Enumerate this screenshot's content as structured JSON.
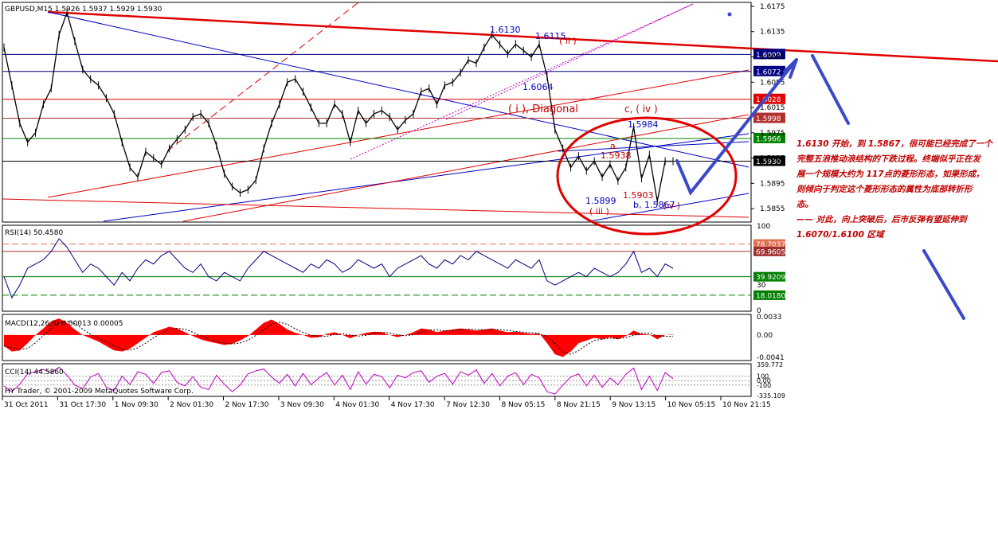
{
  "window": {
    "symbol_line": "GBPUSD,M15 1.5926 1.5937 1.5929 1.5930",
    "copyright": "HY Trader, © 2001-2009 MetaQuotes Software Corp."
  },
  "colors": {
    "price": "#000000",
    "trend_red": "#e00000",
    "trend_blue": "#0000c0",
    "hline_blue": "#000080",
    "hline_red": "#e00000",
    "hline_green": "#008000",
    "rsi": "#000080",
    "macd": "#ff0000",
    "cci": "#c000c0",
    "annotation_blue": "#3b49c8",
    "note_red": "#c00000"
  },
  "annotations": {
    "labels": [
      {
        "text": "1.6130",
        "color": "#0000c0"
      },
      {
        "text": "1.6115",
        "color": "#0000c0"
      },
      {
        "text": "( ii )",
        "color": "#c00000"
      },
      {
        "text": "1.6064",
        "color": "#0000c0"
      },
      {
        "text": "( i ), Diagonal",
        "color": "#c00000"
      },
      {
        "text": "c, ( iv )",
        "color": "#c00000"
      },
      {
        "text": "1.5984",
        "color": "#0000c0"
      },
      {
        "text": "a",
        "color": "#c00000"
      },
      {
        "text": "1.5938",
        "color": "#c00000"
      },
      {
        "text": "1.5899",
        "color": "#0000c0"
      },
      {
        "text": "( iii )",
        "color": "#c00000"
      },
      {
        "text": "1.5903",
        "color": "#c00000"
      },
      {
        "text": "b, 1.5867",
        "color": "#0000c0"
      },
      {
        "text": "( v )",
        "color": "#c00000"
      }
    ],
    "note_lines": [
      "1.6130 开始，到 1.5867，很可能已经完成了一个",
      "完整五浪推动浪结构的下跌过程。终端似乎正在发",
      "展一个规模大约为 117点的菱形形态，如果形成，",
      "则倾向于判定这个菱形形态的属性为底部转折形",
      "态。",
      "—— 对此，向上突破后，后市反弹有望延伸到",
      "1.6070/1.6100 区域"
    ]
  },
  "chart_data": [
    {
      "type": "line",
      "panel": "price",
      "title": "GBPUSD,M15 1.5926 1.5937 1.5929 1.5930",
      "ylim": [
        1.5835,
        1.618
      ],
      "y_ticks": [
        "1.6175",
        "1.6135",
        "1.6095",
        "1.6055",
        "1.6015",
        "1.5975",
        "1.5935",
        "1.5895",
        "1.5855"
      ],
      "x_ticks": [
        "31 Oct 2011",
        "31 Oct 17:30",
        "1 Nov 09:30",
        "2 Nov 01:30",
        "2 Nov 17:30",
        "3 Nov 09:30",
        "4 Nov 01:30",
        "4 Nov 17:30",
        "7 Nov 12:30",
        "8 Nov 05:15",
        "8 Nov 21:15",
        "9 Nov 13:15",
        "10 Nov 05:15",
        "10 Nov 21:15"
      ],
      "x": [
        0,
        1,
        2,
        3,
        4,
        5,
        6,
        7,
        8,
        9,
        10,
        11,
        12,
        13,
        14,
        15,
        16,
        17,
        18,
        19,
        20,
        21,
        22,
        23,
        24,
        25,
        26,
        27,
        28,
        29,
        30,
        31,
        32,
        33,
        34,
        35,
        36,
        37,
        38,
        39,
        40,
        41,
        42,
        43,
        44,
        45,
        46,
        47,
        48,
        49,
        50,
        51,
        52,
        53,
        54,
        55,
        56,
        57,
        58,
        59,
        60,
        61,
        62,
        63,
        64,
        65,
        66,
        67,
        68,
        69,
        70,
        71,
        72,
        73,
        74,
        75,
        76,
        77,
        78,
        79,
        80,
        81,
        82,
        83,
        84,
        85
      ],
      "series": [
        {
          "name": "",
          "values": [
            1.611,
            1.605,
            1.599,
            1.596,
            1.5975,
            1.602,
            1.6045,
            1.613,
            1.6165,
            1.612,
            1.6075,
            1.606,
            1.605,
            1.603,
            1.6005,
            1.596,
            1.592,
            1.5905,
            1.5945,
            1.5935,
            1.5925,
            1.595,
            1.5965,
            1.598,
            1.6,
            1.6005,
            1.599,
            1.5955,
            1.591,
            1.589,
            1.588,
            1.5885,
            1.59,
            1.595,
            1.599,
            1.602,
            1.6055,
            1.606,
            1.604,
            1.6015,
            1.599,
            1.599,
            1.602,
            1.6005,
            1.596,
            1.601,
            1.599,
            1.6005,
            1.601,
            1.6,
            1.598,
            1.5995,
            1.6005,
            1.604,
            1.6045,
            1.602,
            1.605,
            1.6055,
            1.607,
            1.609,
            1.6085,
            1.611,
            1.613,
            1.6115,
            1.61,
            1.6115,
            1.6105,
            1.6095,
            1.6115,
            1.6064,
            1.598,
            1.595,
            1.592,
            1.5938,
            1.5915,
            1.593,
            1.5905,
            1.5925,
            1.5899,
            1.592,
            1.5984,
            1.5903,
            1.594,
            1.5867,
            1.593,
            1.593
          ]
        }
      ],
      "horizontal_lines": [
        {
          "value": 1.6099,
          "label": "1.6099",
          "color": "#000080"
        },
        {
          "value": 1.6072,
          "label": "1.6072",
          "color": "#000080"
        },
        {
          "value": 1.6028,
          "label": "1.6028",
          "color": "#e00000"
        },
        {
          "value": 1.5998,
          "label": "1.5998",
          "color": "#b03030"
        },
        {
          "value": 1.5966,
          "label": "1.5966",
          "color": "#008000"
        },
        {
          "value": 1.593,
          "label": "1.5930",
          "color": "#000000"
        }
      ],
      "grid": false
    },
    {
      "type": "line",
      "panel": "rsi",
      "title": "RSI(14) 50.4580",
      "ylim": [
        0,
        100
      ],
      "y_ticks": [
        "100",
        "30",
        "0"
      ],
      "levels": [
        {
          "value": 78.7037,
          "label": "78.7037",
          "color": "#e07050"
        },
        {
          "value": 69.9605,
          "label": "69.9605",
          "color": "#a03030"
        },
        {
          "value": 39.9209,
          "label": "39.9209",
          "color": "#008000"
        },
        {
          "value": 18.018,
          "label": "18.0180",
          "color": "#008000"
        }
      ],
      "x": [
        0,
        1,
        2,
        3,
        4,
        5,
        6,
        7,
        8,
        9,
        10,
        11,
        12,
        13,
        14,
        15,
        16,
        17,
        18,
        19,
        20,
        21,
        22,
        23,
        24,
        25,
        26,
        27,
        28,
        29,
        30,
        31,
        32,
        33,
        34,
        35,
        36,
        37,
        38,
        39,
        40,
        41,
        42,
        43,
        44,
        45,
        46,
        47,
        48,
        49,
        50,
        51,
        52,
        53,
        54,
        55,
        56,
        57,
        58,
        59,
        60,
        61,
        62,
        63,
        64,
        65,
        66,
        67,
        68,
        69,
        70,
        71,
        72,
        73,
        74,
        75,
        76,
        77,
        78,
        79,
        80,
        81,
        82,
        83,
        84,
        85
      ],
      "series": [
        {
          "name": "",
          "values": [
            40,
            15,
            30,
            50,
            55,
            60,
            70,
            85,
            75,
            60,
            45,
            55,
            50,
            40,
            30,
            45,
            35,
            50,
            60,
            55,
            65,
            70,
            60,
            50,
            45,
            55,
            40,
            35,
            45,
            40,
            35,
            50,
            60,
            70,
            65,
            60,
            55,
            50,
            45,
            55,
            50,
            60,
            55,
            45,
            50,
            60,
            55,
            50,
            55,
            40,
            50,
            55,
            60,
            65,
            55,
            50,
            60,
            55,
            65,
            60,
            70,
            65,
            60,
            55,
            50,
            60,
            55,
            50,
            60,
            35,
            30,
            35,
            40,
            45,
            40,
            50,
            45,
            40,
            45,
            55,
            70,
            45,
            50,
            40,
            55,
            50
          ]
        }
      ]
    },
    {
      "type": "area",
      "panel": "macd",
      "title": "MACD(12,26,9) 0.00013 0.00005",
      "ylim": [
        -0.0045,
        0.0036
      ],
      "y_ticks": [
        "0.0033",
        "0.00",
        "-0.0041"
      ],
      "x": [
        0,
        1,
        2,
        3,
        4,
        5,
        6,
        7,
        8,
        9,
        10,
        11,
        12,
        13,
        14,
        15,
        16,
        17,
        18,
        19,
        20,
        21,
        22,
        23,
        24,
        25,
        26,
        27,
        28,
        29,
        30,
        31,
        32,
        33,
        34,
        35,
        36,
        37,
        38,
        39,
        40,
        41,
        42,
        43,
        44,
        45,
        46,
        47,
        48,
        49,
        50,
        51,
        52,
        53,
        54,
        55,
        56,
        57,
        58,
        59,
        60,
        61,
        62,
        63,
        64,
        65,
        66,
        67,
        68,
        69,
        70,
        71,
        72,
        73,
        74,
        75,
        76,
        77,
        78,
        79,
        80,
        81,
        82,
        83,
        84,
        85
      ],
      "series": [
        {
          "name": "",
          "values": [
            -0.002,
            -0.003,
            -0.0028,
            -0.0015,
            0.0,
            0.0012,
            0.0025,
            0.003,
            0.0022,
            0.001,
            0.0,
            -0.0006,
            -0.0012,
            -0.002,
            -0.0028,
            -0.003,
            -0.0025,
            -0.0015,
            -0.0005,
            0.0005,
            0.001,
            0.0015,
            0.0012,
            0.0005,
            -0.0002,
            -0.0008,
            -0.0012,
            -0.0015,
            -0.0018,
            -0.0016,
            -0.001,
            -0.0002,
            0.001,
            0.0022,
            0.0028,
            0.002,
            0.001,
            0.0004,
            0.0,
            -0.0005,
            -0.0004,
            0.0002,
            0.0005,
            0.0,
            -0.0006,
            0.0,
            0.0004,
            0.0006,
            0.0005,
            0.0,
            -0.0004,
            0.0,
            0.0005,
            0.0012,
            0.001,
            0.0005,
            0.0008,
            0.001,
            0.0012,
            0.001,
            0.0008,
            0.001,
            0.0012,
            0.0008,
            0.0005,
            0.0006,
            0.0004,
            0.0002,
            0.0003,
            -0.0015,
            -0.0035,
            -0.004,
            -0.003,
            -0.0015,
            -0.001,
            -0.0005,
            -0.0008,
            -0.0004,
            -0.0008,
            -0.0002,
            0.0008,
            0.0002,
            0.0001,
            -0.0008,
            0.0,
            0.0001
          ]
        }
      ]
    },
    {
      "type": "line",
      "panel": "cci",
      "title": "CCI(14) 44.5860",
      "ylim": [
        -335.109,
        359.772
      ],
      "y_ticks": [
        "359.772",
        "100",
        "0.00",
        "-100",
        "-335.109"
      ],
      "x": [
        0,
        1,
        2,
        3,
        4,
        5,
        6,
        7,
        8,
        9,
        10,
        11,
        12,
        13,
        14,
        15,
        16,
        17,
        18,
        19,
        20,
        21,
        22,
        23,
        24,
        25,
        26,
        27,
        28,
        29,
        30,
        31,
        32,
        33,
        34,
        35,
        36,
        37,
        38,
        39,
        40,
        41,
        42,
        43,
        44,
        45,
        46,
        47,
        48,
        49,
        50,
        51,
        52,
        53,
        54,
        55,
        56,
        57,
        58,
        59,
        60,
        61,
        62,
        63,
        64,
        65,
        66,
        67,
        68,
        69,
        70,
        71,
        72,
        73,
        74,
        75,
        76,
        77,
        78,
        79,
        80,
        81,
        82,
        83,
        84,
        85
      ],
      "series": [
        {
          "name": "",
          "values": [
            -120,
            -250,
            -80,
            150,
            200,
            250,
            180,
            300,
            120,
            -100,
            -180,
            80,
            160,
            -150,
            -220,
            100,
            -90,
            200,
            140,
            -60,
            180,
            220,
            -40,
            -120,
            90,
            -150,
            -200,
            120,
            -80,
            -250,
            -100,
            150,
            220,
            260,
            80,
            -60,
            140,
            -120,
            160,
            -90,
            60,
            180,
            -100,
            120,
            -200,
            200,
            -80,
            140,
            90,
            -160,
            120,
            60,
            180,
            220,
            -40,
            100,
            160,
            -80,
            200,
            120,
            240,
            -60,
            160,
            -120,
            100,
            180,
            -90,
            140,
            60,
            -250,
            -300,
            -100,
            80,
            150,
            -120,
            120,
            -150,
            60,
            -90,
            140,
            280,
            -200,
            100,
            -220,
            180,
            45
          ]
        }
      ]
    }
  ]
}
